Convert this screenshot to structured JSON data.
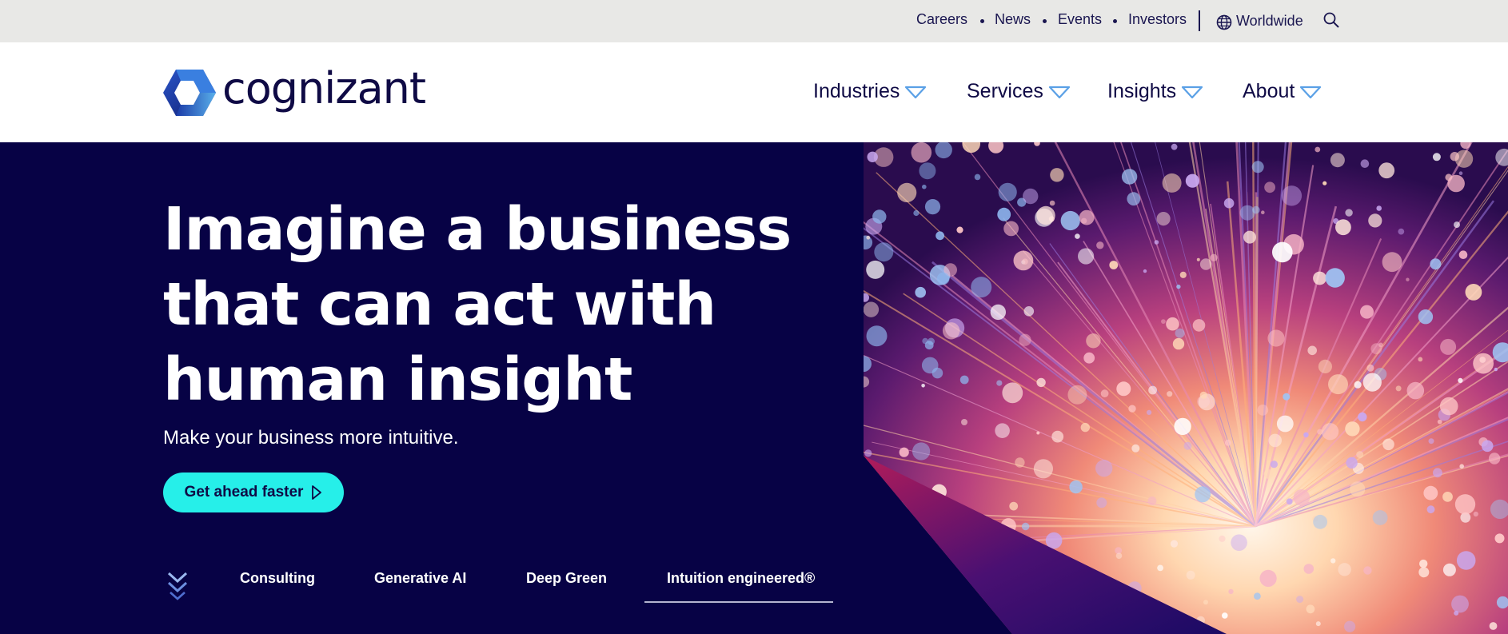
{
  "utility_nav": {
    "links": [
      "Careers",
      "News",
      "Events",
      "Investors"
    ],
    "region_label": "Worldwide",
    "globe_icon": "globe-icon",
    "search_icon": "search-icon"
  },
  "header": {
    "logo_text": "cognizant",
    "nav": [
      {
        "label": "Industries",
        "icon": "chevron-down-icon"
      },
      {
        "label": "Services",
        "icon": "chevron-down-icon"
      },
      {
        "label": "Insights",
        "icon": "chevron-down-icon"
      },
      {
        "label": "About",
        "icon": "chevron-down-icon"
      }
    ]
  },
  "hero": {
    "headline_lines": [
      "Imagine a business",
      "that can act with",
      "human insight"
    ],
    "subhead": "Make your business more intuitive.",
    "cta_label": "Get ahead faster",
    "tabs": [
      "Consulting",
      "Generative AI",
      "Deep Green",
      "Intuition engineered®"
    ],
    "active_tab": "Intuition engineered®"
  },
  "colors": {
    "hero_bg": "#070245",
    "brand_navy": "#0f0a45",
    "cta_bg": "#26efe9",
    "utility_bg": "#e8e8e6",
    "accent_blue": "#5aa0e6"
  }
}
